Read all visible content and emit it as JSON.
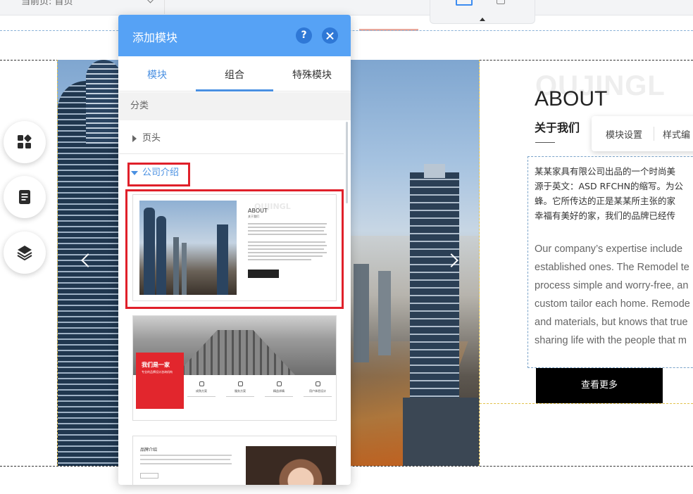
{
  "topbar": {
    "page_label": "当前页: 首页",
    "device_icons": [
      "desktop-icon",
      "mobile-icon"
    ]
  },
  "rail": {
    "icons": [
      "add-module-icon",
      "page-icon",
      "layers-icon"
    ]
  },
  "panel": {
    "title": "添加模块",
    "help_label": "?",
    "tabs": [
      {
        "label": "模块",
        "state": "default-blue"
      },
      {
        "label": "组合",
        "state": "active"
      },
      {
        "label": "特殊模块",
        "state": "default"
      }
    ],
    "category_header": "分类",
    "categories": [
      {
        "label": "页头",
        "expanded": false
      },
      {
        "label": "公司介绍",
        "expanded": true
      }
    ],
    "templates": [
      {
        "ghost": "OUJINGL",
        "heading": "ABOUT",
        "sub": "关于我们"
      },
      {
        "red_title": "我们是一家",
        "red_sub": "专业的品牌设计咨询机构",
        "features": [
          "成熟方案",
          "服务方案",
          "精益求精",
          "用户体验设计"
        ]
      },
      {
        "heading": "品牌介绍"
      }
    ]
  },
  "about": {
    "ghost_text": "OUJINGL",
    "title": "ABOUT",
    "subtitle": "关于我们",
    "toolbar": {
      "settings_label": "模块设置",
      "style_label": "样式编"
    },
    "zh_lines": [
      "某某家具有限公司出品的一个时尚美",
      "源于英文：ASD RFCHN的缩写。为公",
      "蜂。它所传达的正是某某所主张的家",
      "幸福有美好的家，我们的品牌已经传"
    ],
    "en_lines": [
      "Our company’s expertise include",
      "established ones. The Remodel te",
      "process simple and worry-free, an",
      "custom tailor each home. Remode",
      "and materials, but knows that true",
      "sharing life with the people that m"
    ],
    "more_button": "查看更多"
  },
  "colors": {
    "panel_header": "#56a2f5",
    "accent_blue": "#4a90e2",
    "highlight_red": "#e0202a",
    "button_black": "#000000"
  }
}
